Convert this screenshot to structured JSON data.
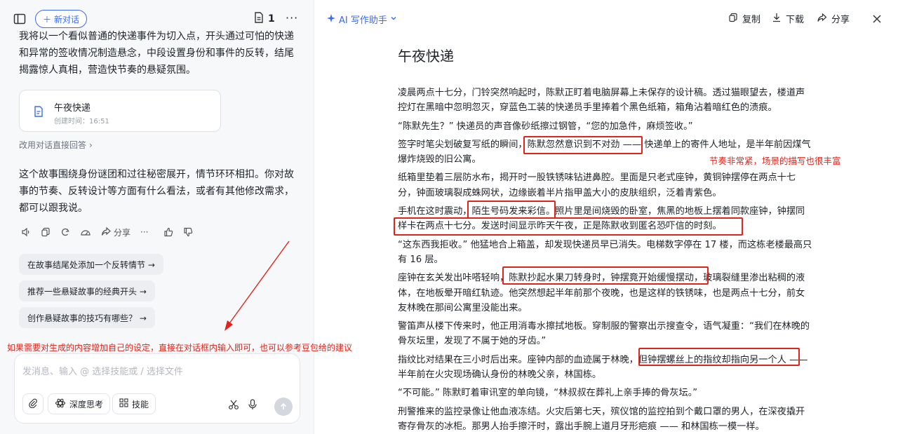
{
  "left": {
    "new_chat_label": "新对话",
    "doc_count": "1",
    "intro_text": "我将以一个看似普通的快递事件为切入点，开头通过可怕的快递和异常的签收情况制造悬念，中段设置身份和事件的反转，结尾揭露惊人真相，营造快节奏的悬疑氛围。",
    "doc_card": {
      "title": "午夜快递",
      "time": "创建时间：16:51"
    },
    "direct_reply": "改用对话直接回答",
    "summary_text": "这个故事围绕身份谜团和过往秘密展开，情节环环相扣。你对故事的节奏、反转设计等方面有什么看法，或者有其他修改需求，都可以跟我说。",
    "share_label": "分享",
    "suggestions": [
      "在故事结尾处添加一个反转情节 →",
      "推荐一些悬疑故事的经典开头 →",
      "创作悬疑故事的技巧有哪些？ →"
    ],
    "annotation": "如果需要对生成的内容增加自己的设定，直接在对话框内输入即可，也可以参考豆包给的建议",
    "composer": {
      "placeholder": "发消息、输入 @ 选择技能或 / 选择文件",
      "deep_think": "深度思考",
      "skills": "技能"
    }
  },
  "right": {
    "assistant_label": "AI 写作助手",
    "copy_label": "复制",
    "download_label": "下载",
    "share_label": "分享",
    "doc_title": "午夜快递",
    "annotation": "节奏非常紧，场景的描写也很丰富",
    "paragraphs": [
      "凌晨两点十七分，门铃突然响起时，陈默正盯着电脑屏幕上未保存的设计稿。透过猫眼望去，楼道声控灯在黑暗中忽明忽灭，穿蓝色工装的快递员手里捧着个黑色纸箱，箱角沾着暗红色的渍痕。",
      "“陈默先生？” 快递员的声音像砂纸擦过钢管，“您的加急件，麻烦签收。”",
      "签字时笔尖划破复写纸的瞬间，陈默忽然意识到不对劲 —— 快递单上的寄件人地址，是半年前因煤气爆炸烧毁的旧公寓。",
      "纸箱里垫着三层防水布，揭开时一股铁锈味钻进鼻腔。里面是只老式座钟，黄铜钟摆停在两点十七分，钟面玻璃裂成蛛网状，边缘嵌着半片指甲盖大小的皮肤组织，泛着青紫色。",
      "手机在这时震动，陌生号码发来彩信。照片里是间烧毁的卧室，焦黑的地板上摆着同款座钟，钟摆同样卡在两点十七分。发送时间显示昨天午夜，正是陈默收到匿名恐吓信的时刻。",
      "“这东西我拒收。” 他猛地合上箱盖，却发现快递员早已消失。电梯数字停在 17 楼，而这栋老楼最高只有 16 层。",
      "座钟在玄关发出咔嗒轻响，陈默抄起水果刀转身时，钟摆竟开始缓慢摆动，玻璃裂缝里渗出粘稠的液体，在地板晕开暗红轨迹。他突然想起半年前那个夜晚，也是这样的铁锈味，也是两点十七分，前女友林晚在那间公寓里没能出来。",
      "警笛声从楼下传来时，他正用消毒水擦拭地板。穿制服的警察出示搜查令，语气凝重：“我们在林晚的骨灰坛里，发现了不属于她的牙齿。”",
      "指纹比对结果在三小时后出来。座钟内部的血迹属于林晚，但钟摆螺丝上的指纹却指向另一个人 —— 半年前在火灾现场确认身份的林晚父亲，林国栋。",
      "“不可能。” 陈默盯着审讯室的单向镜，“林叔叔在葬礼上亲手捧的骨灰坛。”",
      "刑警推来的监控录像让他血液冻结。火灾后第七天，殡仪馆的监控拍到个戴口罩的男人，在深夜撬开寄存骨灰的冰柜。那男人抬手擦汗时，露出手腕上道月牙形疤痕 —— 和林国栋一模一样。"
    ]
  }
}
